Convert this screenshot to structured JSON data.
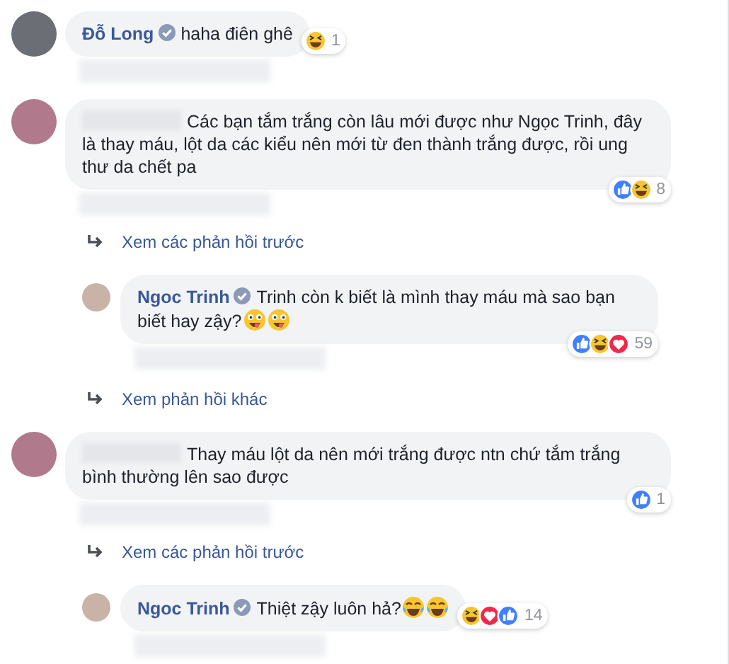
{
  "items": [
    {
      "kind": "comment",
      "author": "Đỗ Long",
      "verified": true,
      "text": "haha điên ghê",
      "reactions": [
        {
          "kind": "haha"
        }
      ],
      "reaction_count": "1"
    },
    {
      "kind": "comment",
      "text": "Các bạn tắm trắng còn lâu mới được như Ngọc Trinh, đây là thay máu, lột da các kiểu nên mới từ đen thành trắng được, rồi ung thư da chết pa",
      "reactions": [
        {
          "kind": "like"
        },
        {
          "kind": "haha"
        }
      ],
      "reaction_count": "8"
    },
    {
      "kind": "link",
      "text": "Xem các phản hồi trước"
    },
    {
      "kind": "reply",
      "author": "Ngoc Trinh",
      "verified": true,
      "text": "Trinh còn k biết là mình thay máu mà sao bạn biết hay zậy?",
      "emojis": [
        {
          "kind": "tongue"
        },
        {
          "kind": "tongue"
        }
      ],
      "reactions": [
        {
          "kind": "like"
        },
        {
          "kind": "haha"
        },
        {
          "kind": "love"
        }
      ],
      "reaction_count": "59"
    },
    {
      "kind": "link",
      "text": "Xem phản hồi khác"
    },
    {
      "kind": "comment",
      "text": "Thay máu lột da nên mới trắng được ntn chứ tắm trắng bình thường lên sao được",
      "reactions": [
        {
          "kind": "like"
        }
      ],
      "reaction_count": "1"
    },
    {
      "kind": "link",
      "text": "Xem các phản hồi trước"
    },
    {
      "kind": "reply",
      "author": "Ngoc Trinh",
      "verified": true,
      "text": "Thiệt zậy luôn hả?",
      "emojis": [
        {
          "kind": "tears"
        },
        {
          "kind": "tears"
        }
      ],
      "reactions": [
        {
          "kind": "haha"
        },
        {
          "kind": "love"
        },
        {
          "kind": "like"
        }
      ],
      "reaction_count": "14"
    }
  ]
}
